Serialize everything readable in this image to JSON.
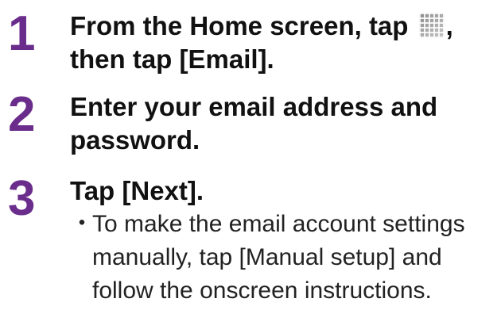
{
  "steps": [
    {
      "number": "1",
      "text_before_icon": "From the Home screen, tap",
      "text_after_icon": ",",
      "line2": "then tap [Email].",
      "icon": "apps-grid-icon"
    },
    {
      "number": "2",
      "line1": "Enter your email address and",
      "line2": "password."
    },
    {
      "number": "3",
      "line1": "Tap [Next].",
      "note": {
        "bullet": "・",
        "lines": [
          "To make the email account settings",
          "manually, tap [Manual setup] and",
          "follow the onscreen instructions."
        ]
      }
    }
  ],
  "colors": {
    "step_number": "#6a2d8c",
    "text": "#111111"
  }
}
